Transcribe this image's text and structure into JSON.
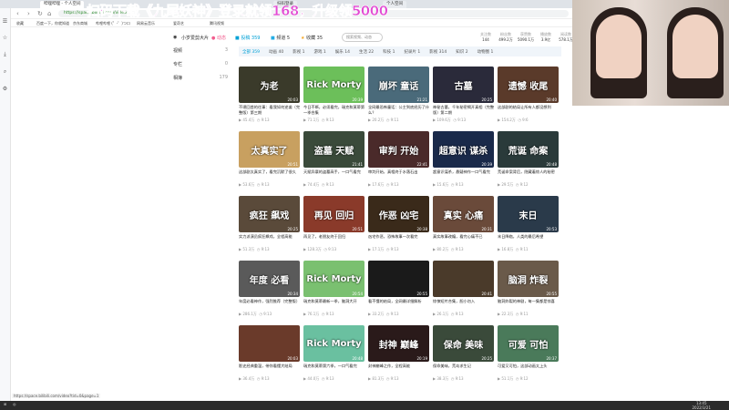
{
  "browser": {
    "tabs": [
      "哔哩哔哩 - 个人空间",
      "扫码登录",
      "个人空间"
    ],
    "url": "https://space.bilibili.com/video",
    "bookmarks": [
      "收藏",
      "百度一下，你就知道",
      "京东商城",
      "哔哩哔哩 (゜-゜)つロ",
      "网易云音乐",
      "爱奇艺",
      "腾讯视频"
    ],
    "status_url": "https://space.bilibili.com/video?tid=0&page=1"
  },
  "promo": "扫码下载《九尾妖神》登录就领168，升级领5000",
  "header": {
    "username": "小岁爱剪大片",
    "items": [
      {
        "label": "动态",
        "color": "#f25d8e"
      },
      {
        "label": "投稿 359",
        "color": "#00a1d6"
      },
      {
        "label": "频道 5",
        "color": "#23ade5"
      },
      {
        "label": "收藏 35",
        "color": "#f5a623"
      }
    ],
    "search_placeholder": "搜索视频、动态",
    "stats": [
      {
        "label": "关注数",
        "value": "144"
      },
      {
        "label": "粉丝数",
        "value": "499.2万"
      },
      {
        "label": "获赞数",
        "value": "5090.1万"
      },
      {
        "label": "播放数",
        "value": "3.9亿"
      },
      {
        "label": "阅读数",
        "value": "578.1万"
      }
    ]
  },
  "left_nav": [
    {
      "label": "视频",
      "count": "3"
    },
    {
      "label": "专栏",
      "count": "0"
    },
    {
      "label": "相簿",
      "count": "179"
    }
  ],
  "subtabs": [
    "全部 359",
    "动画 40",
    "影视 1",
    "游戏 1",
    "娱乐 14",
    "生活 22",
    "科技 1",
    "纪录片 1",
    "影视 314",
    "知识 2",
    "动物圈 1"
  ],
  "videos": [
    {
      "t": "为老",
      "title": "不堪回首的往事：看我如何逆袭（完整版）第三期",
      "v": "45.4万",
      "d": "9:13",
      "dur": "20:03",
      "c": "#3a3a2a"
    },
    {
      "t": "Rick Morty",
      "title": "今日不断，必须看完，瑞克和莫蒂第一季合集",
      "v": "71.1万",
      "d": "9:13",
      "dur": "20:39",
      "c": "#6cbf5a"
    },
    {
      "t": "崩坏 童话",
      "title": "全网最恐怖童话：公主到底经历了什么？",
      "v": "20.2万",
      "d": "9:11",
      "dur": "21:21",
      "c": "#4a6a7a"
    },
    {
      "t": "古墓",
      "title": "神秘古墓，千年秘密揭开真相（完整版）第二期",
      "v": "109.6万",
      "d": "9:13",
      "dur": "20:25",
      "c": "#2a2a3a"
    },
    {
      "t": "遗憾 收尾",
      "title": "这部剧的结局让所有人都没想到",
      "v": "154.2万",
      "d": "9:6",
      "dur": "20:40",
      "c": "#5a3a2a"
    },
    {
      "t": "太真实了",
      "title": "这部剧太真实了，看完沉默了很久",
      "v": "53.6万",
      "d": "9:13",
      "dur": "20:51",
      "c": "#c8a060"
    },
    {
      "t": "盗墓 天赋",
      "title": "天赋异禀的盗墓高手，一口气看完",
      "v": "74.4万",
      "d": "9:13",
      "dur": "21:41",
      "c": "#3a4a3a"
    },
    {
      "t": "审判 开始",
      "title": "审判开始，真相终于水落石出",
      "v": "17.6万",
      "d": "9:13",
      "dur": "22:41",
      "c": "#4a2a2a"
    },
    {
      "t": "超意识 谋杀",
      "title": "超意识谋杀，悬疑神作一口气看完",
      "v": "15.6万",
      "d": "9:13",
      "dur": "20:39",
      "c": "#1a2a4a"
    },
    {
      "t": "荒诞 命案",
      "title": "荒诞命案背后，隐藏着惊人的秘密",
      "v": "29.5万",
      "d": "9:12",
      "dur": "20:48",
      "c": "#2a3a3a"
    },
    {
      "t": "疯狂 飙戏",
      "title": "实力派演员疯狂飙戏，全程高能",
      "v": "51.3万",
      "d": "9:13",
      "dur": "20:25",
      "c": "#5a4a3a"
    },
    {
      "t": "再见 回归",
      "title": "再见了，老朋友终于回归",
      "v": "128.3万",
      "d": "9:13",
      "dur": "20:51",
      "c": "#8a3a2a"
    },
    {
      "t": "作恶 凶宅",
      "title": "凶宅作恶，恐怖故事一次看完",
      "v": "17.1万",
      "d": "9:13",
      "dur": "20:38",
      "c": "#3a2a1a"
    },
    {
      "t": "真实 心痛",
      "title": "真实故事改编，看完心痛不已",
      "v": "80.2万",
      "d": "9:13",
      "dur": "20:31",
      "c": "#6a4a3a"
    },
    {
      "t": "末日",
      "title": "末日降临，人类的最后希望",
      "v": "16.8万",
      "d": "9:11",
      "dur": "20:53",
      "c": "#2a3a4a"
    },
    {
      "t": "年度 必看",
      "title": "年度必看神作，强烈推荐（完整版）",
      "v": "286.1万",
      "d": "9:13",
      "dur": "20:34",
      "c": "#5a5a5a"
    },
    {
      "t": "Rick Morty",
      "title": "瑞克和莫蒂最新一季，脑洞大开",
      "v": "76.1万",
      "d": "9:13",
      "dur": "20:54",
      "c": "#7ac070"
    },
    {
      "t": "",
      "title": "看不懂的结局，全网最详细解析",
      "v": "33.2万",
      "d": "9:13",
      "dur": "20:55",
      "c": "#1a1a1a"
    },
    {
      "t": "",
      "title": "惊悚短片合集，胆小勿入",
      "v": "26.1万",
      "d": "9:13",
      "dur": "20:41",
      "c": "#4a3a2a"
    },
    {
      "t": "脑洞 炸裂",
      "title": "脑洞炸裂的神剧，每一集都是惊喜",
      "v": "22.3万",
      "d": "9:11",
      "dur": "20:55",
      "c": "#6a5a4a"
    },
    {
      "t": "",
      "title": "影史经典重温，带你看懂大结局",
      "v": "36.4万",
      "d": "9:13",
      "dur": "20:03",
      "c": "#6a3a2a"
    },
    {
      "t": "Rick Morty",
      "title": "瑞克和莫蒂第六季，一口气看完",
      "v": "44.0万",
      "d": "9:13",
      "dur": "20:48",
      "c": "#6ac0a0"
    },
    {
      "t": "封神 巅峰",
      "title": "封神巅峰之作，全程高能",
      "v": "81.3万",
      "d": "9:13",
      "dur": "20:19",
      "c": "#2a1a1a"
    },
    {
      "t": "保命 美味",
      "title": "保命美味，荒岛求生记",
      "v": "38.3万",
      "d": "9:13",
      "dur": "20:25",
      "c": "#3a4a3a"
    },
    {
      "t": "可爱 可怕",
      "title": "可爱又可怕，这部动画太上头",
      "v": "51.1万",
      "d": "9:12",
      "dur": "20:37",
      "c": "#4a7a5a"
    }
  ],
  "taskbar": {
    "time": "13:45",
    "date": "2022/3/21"
  }
}
